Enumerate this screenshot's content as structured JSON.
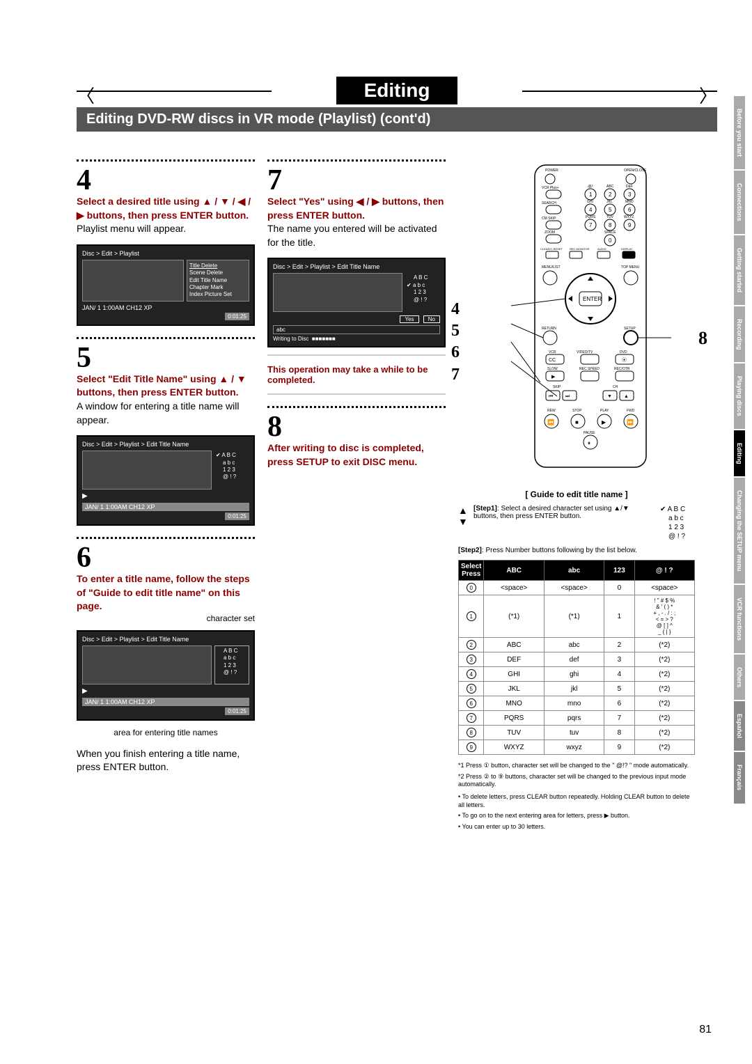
{
  "title": "Editing",
  "subtitle": "Editing DVD-RW discs in VR mode (Playlist) (cont'd)",
  "steps": {
    "s4": {
      "num": "4",
      "head": "Select a desired title using ▲ / ▼ / ◀ / ▶ buttons, then press ENTER button.",
      "body": "Playlist menu will appear."
    },
    "s5": {
      "num": "5",
      "head": "Select \"Edit Title Name\" using ▲ / ▼ buttons, then press ENTER button.",
      "body": "A window for entering a title name will appear."
    },
    "s6": {
      "num": "6",
      "head": "To enter a title name, follow the steps of \"Guide to edit title name\" on this page.",
      "charset_label": "character set",
      "area_label": "area for entering title names",
      "footer": "When you finish entering a title name, press ENTER button."
    },
    "s7": {
      "num": "7",
      "head": "Select \"Yes\" using ◀ / ▶ buttons, then press ENTER button.",
      "body": "The name you entered will be activated for the title.",
      "note": "This operation may take a while to be completed."
    },
    "s8": {
      "num": "8",
      "head": "After writing to disc is completed, press SETUP to exit DISC menu."
    }
  },
  "shot1": {
    "crumb": "Disc > Edit > Playlist",
    "menu": [
      "Title Delete",
      "Scene Delete",
      "Edit Title Name",
      "Chapter Mark",
      "Index Picture Set"
    ],
    "status": "JAN/ 1  1:00AM  CH12   XP",
    "time": "0:01:25"
  },
  "shot2": {
    "crumb": "Disc > Edit > Playlist > Edit Title Name",
    "modes": [
      "A B C",
      "a b c",
      "1 2 3",
      "@ ! ?"
    ],
    "status": "JAN/ 1  1:00AM  CH12   XP",
    "time": "0:01:25"
  },
  "shot3": {
    "crumb": "Disc > Edit  > Playlist > Edit Title Name",
    "modes": [
      "A B C",
      "a b c",
      "1 2 3",
      "@ ! ?"
    ],
    "status": "JAN/ 1  1:00AM  CH12   XP",
    "time": "0:01:25"
  },
  "shot4": {
    "crumb": "Disc > Edit > Playlist > Edit Title Name",
    "modes": [
      "A B C",
      "a b c",
      "1 2 3",
      "@ ! ?"
    ],
    "yes": "Yes",
    "no": "No",
    "input": "abc",
    "writing": "Writing to Disc"
  },
  "remote_nums": {
    "a": "4",
    "b": "5",
    "c": "6",
    "d": "7",
    "e": "8"
  },
  "guide": {
    "title": "[ Guide to edit title name ]",
    "step1_label": "[Step1]",
    "step1": ": Select a desired character set using ▲/▼ buttons, then press ENTER button.",
    "step2_label": "[Step2]",
    "step2": ": Press Number buttons following by the list below.",
    "modes": [
      "A B C",
      "a b c",
      "1 2 3",
      "@ ! ?"
    ]
  },
  "table": {
    "headers": [
      "Select\nPress",
      "ABC",
      "abc",
      "123",
      "@ ! ?"
    ],
    "rows": [
      {
        "key": "0",
        "c": [
          "<space>",
          "<space>",
          "0",
          "<space>"
        ]
      },
      {
        "key": "1",
        "c": [
          "(*1)",
          "(*1)",
          "1",
          "! \" # $ %\n& ' ( ) *\n+ , - . / : ;\n< = > ?\n@ [ ] ^\n_ { | }"
        ]
      },
      {
        "key": "2",
        "c": [
          "ABC",
          "abc",
          "2",
          "(*2)"
        ]
      },
      {
        "key": "3",
        "c": [
          "DEF",
          "def",
          "3",
          "(*2)"
        ]
      },
      {
        "key": "4",
        "c": [
          "GHI",
          "ghi",
          "4",
          "(*2)"
        ]
      },
      {
        "key": "5",
        "c": [
          "JKL",
          "jkl",
          "5",
          "(*2)"
        ]
      },
      {
        "key": "6",
        "c": [
          "MNO",
          "mno",
          "6",
          "(*2)"
        ]
      },
      {
        "key": "7",
        "c": [
          "PQRS",
          "pqrs",
          "7",
          "(*2)"
        ]
      },
      {
        "key": "8",
        "c": [
          "TUV",
          "tuv",
          "8",
          "(*2)"
        ]
      },
      {
        "key": "9",
        "c": [
          "WXYZ",
          "wxyz",
          "9",
          "(*2)"
        ]
      }
    ]
  },
  "footnotes": {
    "f1": "*1 Press ① button, character set will be changed to the \" @!? \" mode automatically.",
    "f2": "*2 Press ② to ⑨ buttons, character set will be changed to the previous input mode automatically.",
    "b1": "• To delete letters, press CLEAR button repeatedly. Holding CLEAR button to delete all letters.",
    "b2": "• To go on to the next entering area for letters, press ▶ button.",
    "b3": "• You can enter up to 30 letters."
  },
  "tabs": [
    "Before you start",
    "Connections",
    "Getting started",
    "Recording",
    "Playing discs",
    "Editing",
    "Changing the SETUP menu",
    "VCR functions",
    "Others",
    "Español",
    "Français"
  ],
  "page_num": "81"
}
